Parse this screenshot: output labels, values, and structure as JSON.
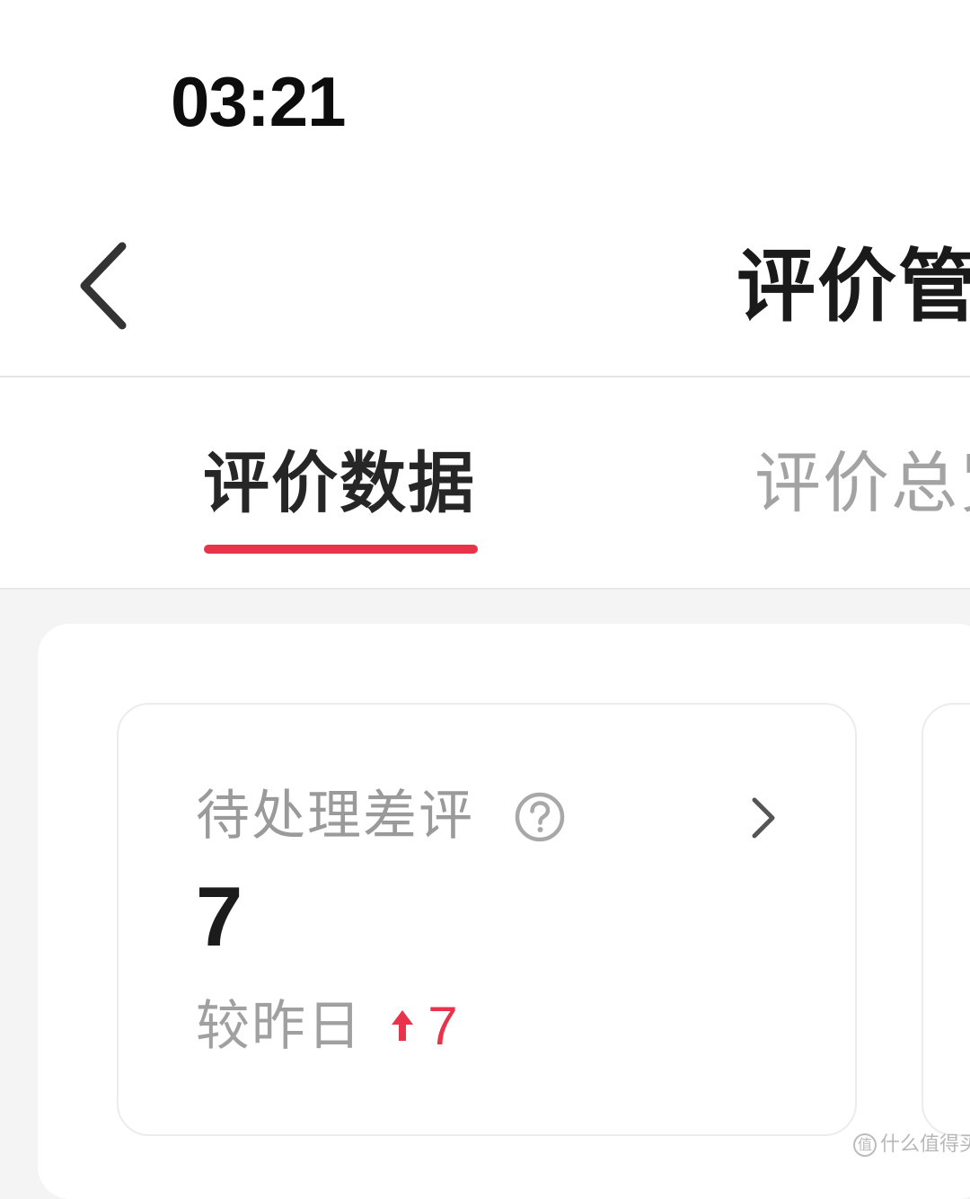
{
  "status_bar": {
    "time": "03:21"
  },
  "nav": {
    "back_icon": "chevron-left-icon",
    "title": "评价管理"
  },
  "tabs": [
    {
      "label": "评价数据",
      "active": true
    },
    {
      "label": "评价总览",
      "active": false
    }
  ],
  "colors": {
    "accent": "#e8334a",
    "muted_text": "#9a9a9a",
    "primary_text": "#1c1c1c",
    "page_background": "#f4f4f4"
  },
  "stat_cards": [
    {
      "label": "待处理差评",
      "help_icon": "question-circle-icon",
      "chevron_icon": "chevron-right-icon",
      "value": "7",
      "compare_label": "较昨日",
      "trend_icon": "arrow-up-icon",
      "compare_value": "7"
    }
  ],
  "watermark": {
    "badge": "值",
    "text": "什么值得买"
  }
}
